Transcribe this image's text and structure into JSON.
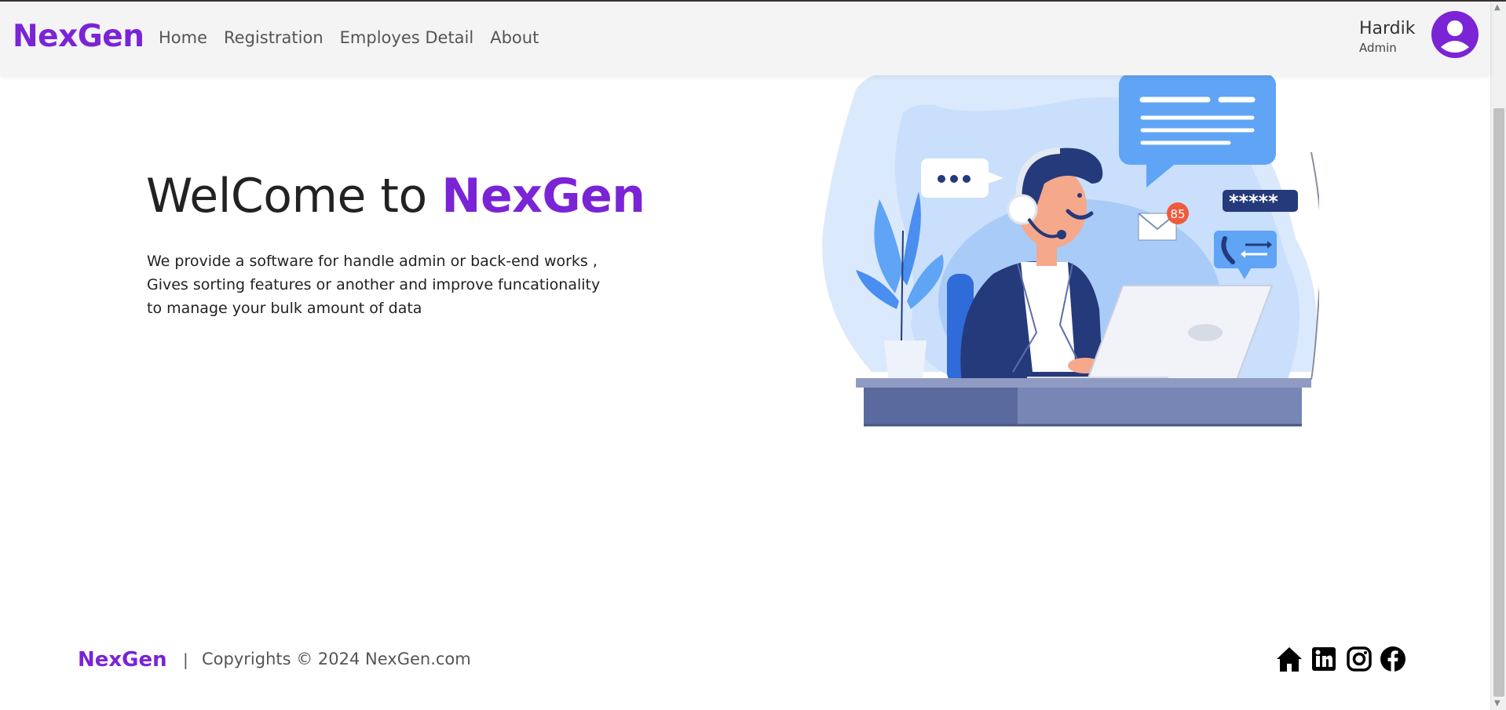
{
  "navbar": {
    "brand": "NexGen",
    "links": [
      "Home",
      "Registration",
      "Employes Detail",
      "About"
    ],
    "user": {
      "name": "Hardik",
      "role": "Admin",
      "avatar_icon": "user-avatar-icon"
    }
  },
  "hero": {
    "title_prefix": "WelCome to ",
    "title_accent": "NexGen",
    "description_lines": [
      "We provide a software for handle admin or back-end works ,",
      "Gives sorting features or another and improve funcationality",
      "to manage your bulk amount of data"
    ],
    "illustration": {
      "badge_count": "85",
      "password_mask": "*****",
      "icons": [
        "support-agent-illustration",
        "chat-bubble-icon",
        "mail-icon",
        "phone-transfer-icon",
        "potted-plant",
        "laptop"
      ]
    }
  },
  "footer": {
    "brand": "NexGen",
    "separator": "|",
    "copyright": "Copyrights © 2024 NexGen.com",
    "social_icons": [
      "home-icon",
      "linkedin-icon",
      "instagram-icon",
      "facebook-icon"
    ]
  },
  "colors": {
    "brand": "#7a24d6",
    "navbar_bg": "#f4f4f4",
    "text": "#222222",
    "illustration_light": "#c9dffb",
    "illustration_mid": "#5fa4f5",
    "illustration_dark": "#253a7a"
  }
}
